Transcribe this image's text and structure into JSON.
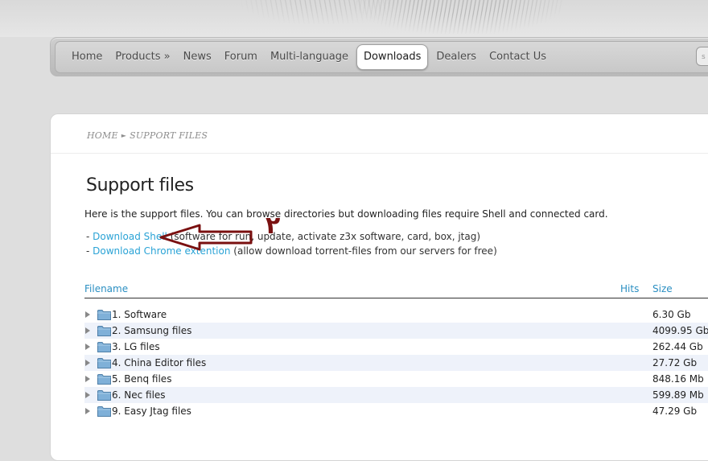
{
  "nav": {
    "items": [
      {
        "label": "Home",
        "active": false
      },
      {
        "label": "Products »",
        "active": false
      },
      {
        "label": "News",
        "active": false
      },
      {
        "label": "Forum",
        "active": false
      },
      {
        "label": "Multi-language",
        "active": false
      },
      {
        "label": "Downloads",
        "active": true
      },
      {
        "label": "Dealers",
        "active": false
      },
      {
        "label": "Contact Us",
        "active": false
      }
    ],
    "search_placeholder": "s"
  },
  "breadcrumb": {
    "home": "HOME",
    "current": "SUPPORT FILES"
  },
  "page": {
    "title": "Support files",
    "intro": "Here is the support files. You can browse directories but downloading files require Shell and connected card.",
    "links": [
      {
        "prefix": "- ",
        "link": "Download Shell",
        "suffix": " (software for run, update, activate z3x software, card, box, jtag)"
      },
      {
        "prefix": "- ",
        "link": "Download Chrome extention",
        "suffix": " (allow download torrent-files from our servers for free)"
      }
    ]
  },
  "table": {
    "headers": {
      "filename": "Filename",
      "hits": "Hits",
      "size": "Size"
    },
    "rows": [
      {
        "name": "1. Software",
        "size": "6.30 Gb"
      },
      {
        "name": "2. Samsung files",
        "size": "4099.95 Gb"
      },
      {
        "name": "3. LG files",
        "size": "262.44 Gb"
      },
      {
        "name": "4. China Editor files",
        "size": "27.72 Gb"
      },
      {
        "name": "5. Benq files",
        "size": "848.16 Mb"
      },
      {
        "name": "6. Nec files",
        "size": "599.89 Mb"
      },
      {
        "name": "9. Easy Jtag files",
        "size": "47.29 Gb"
      }
    ]
  },
  "annotation": {
    "text": "٢",
    "color": "#7a1010"
  },
  "colors": {
    "link": "#2aa3d6",
    "header_link": "#2b8fc2",
    "alt_row": "#eef2fa",
    "folder": "#7fb0d8"
  }
}
